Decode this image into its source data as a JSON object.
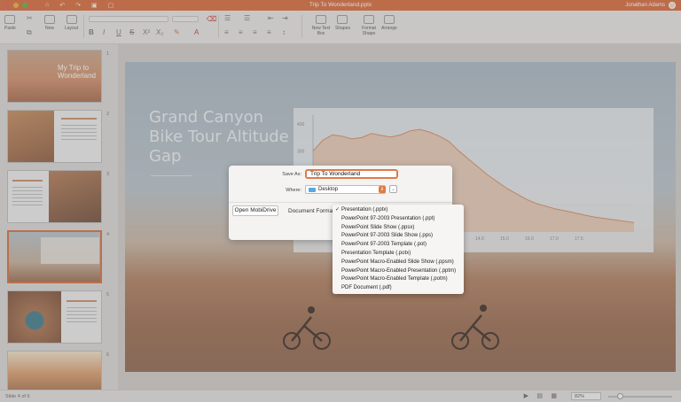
{
  "window": {
    "title": "Trip To Wonderland.pptx",
    "user": "Jonathan Adams",
    "colors": {
      "accent": "#d9693a",
      "close": "#e25c4c",
      "minimize": "#e7b13a",
      "maximize": "#4fb64b"
    }
  },
  "toolbar": {
    "paste": "Paste",
    "new": "New",
    "layout": "Layout",
    "new_text_box": "New Text Box",
    "shapes": "Shapes",
    "format_shape": "Format Shape",
    "arrange": "Arrange"
  },
  "thumbnails": {
    "numbers": [
      "1",
      "2",
      "3",
      "4",
      "5",
      "6"
    ],
    "slide1_title": "My Trip to Wonderland",
    "selected": 4
  },
  "slide": {
    "title": "Grand Canyon Bike Tour Altitude Gap"
  },
  "chart_data": {
    "type": "area",
    "ylabel_ticks": [
      "400",
      "300",
      "200",
      "100"
    ],
    "x_ticks": [
      "14.0",
      "15.0",
      "16.0",
      "17.0",
      "17.5"
    ],
    "ylim": [
      0,
      420
    ],
    "values": [
      300,
      340,
      360,
      355,
      345,
      350,
      365,
      358,
      352,
      360,
      375,
      380,
      370,
      355,
      335,
      300,
      270,
      240,
      210,
      185,
      160,
      140,
      120,
      105,
      95,
      85,
      78,
      70,
      62,
      55,
      50,
      45,
      40,
      35
    ]
  },
  "dialog": {
    "save_as_label": "Save As:",
    "save_as_value": "Trip To Wonderland",
    "where_label": "Where:",
    "where_value": "Desktop",
    "open_mobidrive": "Open MobiDrive",
    "document_format_label": "Document Format"
  },
  "format_menu": {
    "items": [
      "Presentation (.pptx)",
      "PowerPoint 97-2003 Presentation (.ppt)",
      "PowerPoint Slide Show (.ppsx)",
      "PowerPoint 97-2003 Slide Show (.pps)",
      "PowerPoint 97-2003 Template (.pot)",
      "Presentation Template (.potx)",
      "PowerPoint Macro-Enabled Slide Show (.ppsm)",
      "PowerPoint Macro-Enabled Presentation (.pptm)",
      "PowerPoint Macro-Enabled Template (.potm)",
      "PDF Document (.pdf)"
    ],
    "selected_index": 0,
    "checkmark": "✓"
  },
  "status": {
    "slide_count": "Slide 4 of 6",
    "zoom": "82%"
  }
}
